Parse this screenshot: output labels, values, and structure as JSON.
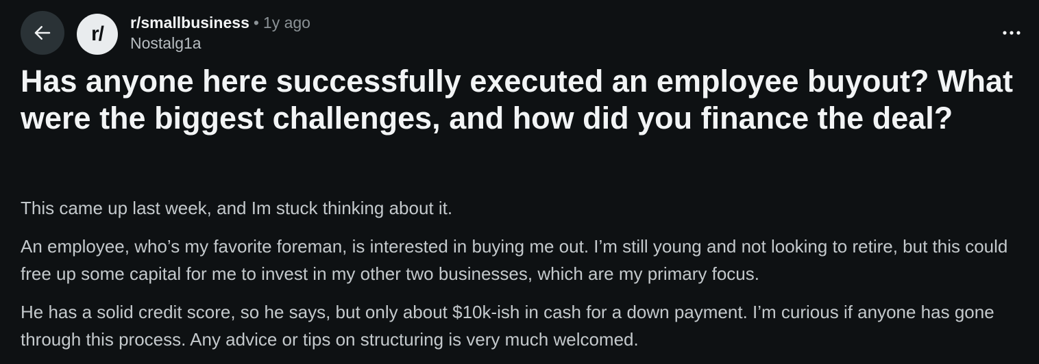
{
  "post": {
    "subreddit": "r/smallbusiness",
    "separator": "•",
    "age": "1y ago",
    "author": "Nostalg1a",
    "title": "Has anyone here successfully executed an employee buyout? What were the biggest challenges, and how did you finance the deal?",
    "paragraphs": [
      "This came up last week, and Im stuck thinking about it.",
      "An employee, who’s my favorite foreman, is interested in buying me out. I’m still young and not looking to retire, but this could free up some capital for me to invest in my other two businesses, which are my primary focus.",
      "He has a solid credit score, so he says, but only about $10k-ish in cash for a down payment. I’m curious if anyone has gone through this process. Any advice or tips on structuring is very much welcomed."
    ]
  },
  "icons": {
    "back": "arrow-left-icon",
    "subreddit_avatar": "reddit-r-slash-icon",
    "overflow": "more-horizontal-icon"
  },
  "avatar_text": "r/",
  "colors": {
    "background": "#0e1113",
    "back_button_bg": "#2a3236",
    "avatar_bg": "#e9ecee",
    "title": "#f2f4f5",
    "body": "#c4c9cc",
    "muted": "#8b9296"
  }
}
